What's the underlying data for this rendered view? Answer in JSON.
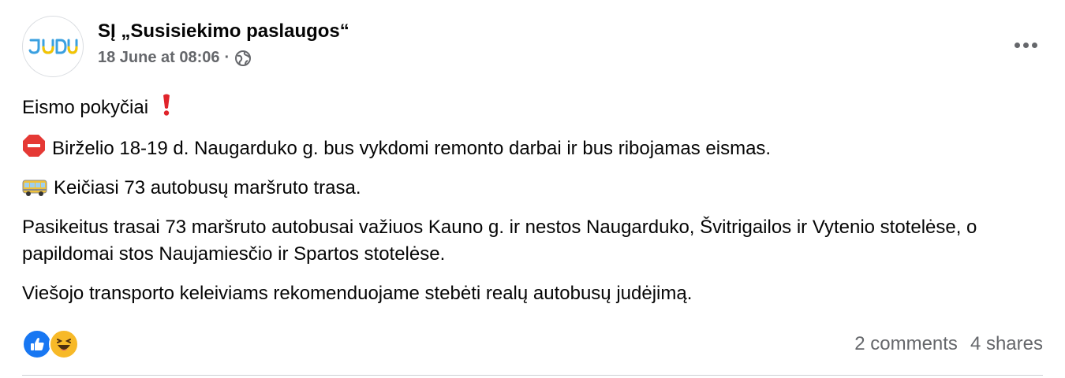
{
  "post": {
    "author": "SĮ „Susisiekimo paslaugos“",
    "avatar_logo": "JUDU",
    "timestamp": "18 June at 08:06",
    "separator": "·",
    "privacy_icon": "globe-icon",
    "menu_icon": "more-options-icon"
  },
  "body": {
    "line1": "Eismo pokyčiai",
    "line1_icon": "red-exclamation-icon",
    "line2": "Birželio 18-19 d. Naugarduko g. bus vykdomi remonto darbai ir bus ribojamas eismas.",
    "line2_icon": "stop-sign-icon",
    "line3": "Keičiasi  73 autobusų maršruto trasa.",
    "line3_icon": "bus-icon",
    "line4": "Pasikeitus trasai 73 maršruto autobusai važiuos Kauno g. ir nestos Naugarduko, Švitrigailos ir Vytenio stotelėse, o papildomai stos Naujamiesčio ir Spartos stotelėse.",
    "line5": "Viešojo transporto keleiviams rekomenduojame stebėti realų autobusų judėjimą."
  },
  "footer": {
    "reactions": [
      "like-reaction-icon",
      "haha-reaction-icon"
    ],
    "comments": "2 comments",
    "shares": "4 shares"
  },
  "colors": {
    "text": "#050505",
    "secondary": "#65676b",
    "like_blue": "#1877f2",
    "haha_yellow": "#f7b928",
    "logo_blue": "#3aa0e0",
    "logo_yellow": "#f5c400"
  }
}
